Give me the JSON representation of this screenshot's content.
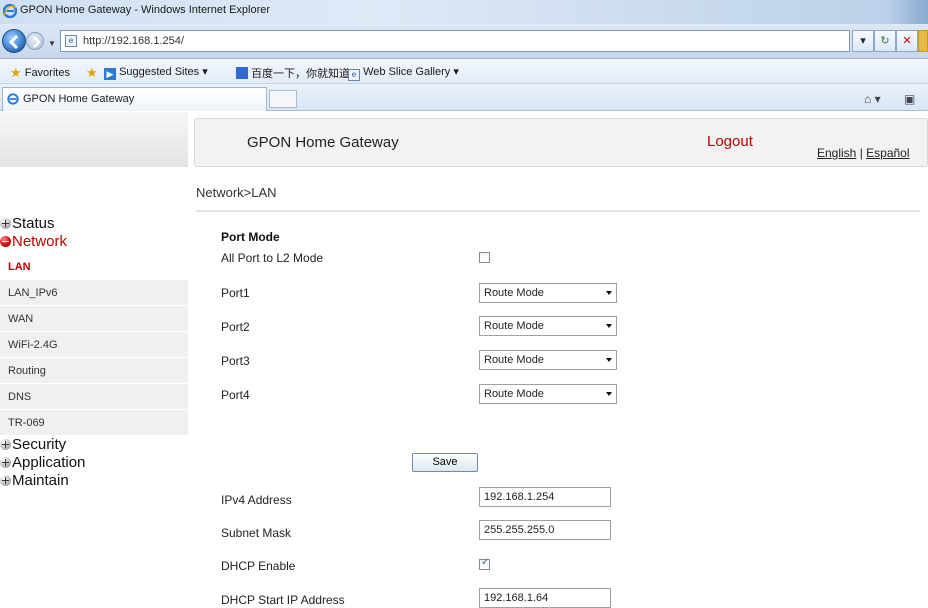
{
  "window": {
    "title": "GPON Home Gateway - Windows Internet Explorer"
  },
  "address": {
    "url": "http://192.168.1.254/"
  },
  "favorites": {
    "favorites_label": "Favorites",
    "suggested_sites": "Suggested Sites ▾",
    "baidu": "百度一下，你就知道",
    "web_slice": "Web Slice Gallery ▾"
  },
  "tab": {
    "label": "GPON Home Gateway"
  },
  "header": {
    "brand": "GPON Home Gateway",
    "logout": "Logout",
    "lang_en": "English",
    "lang_sep": " | ",
    "lang_es": "Español"
  },
  "breadcrumb": "Network>LAN",
  "sidebar": {
    "status": "Status",
    "network": "Network",
    "items": [
      "LAN",
      "LAN_IPv6",
      "WAN",
      "WiFi-2.4G",
      "Routing",
      "DNS",
      "TR-069"
    ],
    "security": "Security",
    "application": "Application",
    "maintain": "Maintain"
  },
  "form": {
    "section_title": "Port Mode",
    "all_port_label": "All Port to L2 Mode",
    "all_port_checked": false,
    "ports": [
      {
        "label": "Port1",
        "value": "Route Mode"
      },
      {
        "label": "Port2",
        "value": "Route Mode"
      },
      {
        "label": "Port3",
        "value": "Route Mode"
      },
      {
        "label": "Port4",
        "value": "Route Mode"
      }
    ],
    "save_label": "Save",
    "ipv4_label": "IPv4 Address",
    "ipv4_value": "192.168.1.254",
    "mask_label": "Subnet Mask",
    "mask_value": "255.255.255.0",
    "dhcp_label": "DHCP Enable",
    "dhcp_checked": true,
    "dhcp_start_label": "DHCP Start IP Address",
    "dhcp_start_value": "192.168.1.64"
  },
  "colors": {
    "accent_red": "#c00000",
    "chrome_blue": "#c6d7ec"
  }
}
